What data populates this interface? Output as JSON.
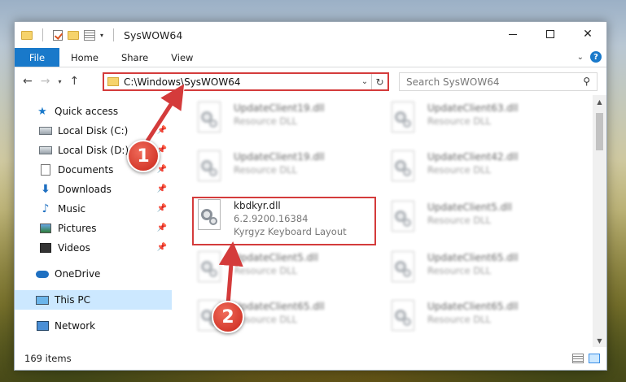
{
  "window": {
    "title": "SysWOW64",
    "minimize": "Minimize",
    "maximize": "Maximize",
    "close": "Close"
  },
  "ribbon": {
    "tabs": [
      "File",
      "Home",
      "Share",
      "View"
    ],
    "help": "?"
  },
  "address": {
    "path": "C:\\Windows\\SysWOW64",
    "search_placeholder": "Search SysWOW64"
  },
  "sidebar": {
    "quick_access": "Quick access",
    "items": [
      "Local Disk (C:)",
      "Local Disk (D:)",
      "Documents",
      "Downloads",
      "Music",
      "Pictures",
      "Videos"
    ],
    "onedrive": "OneDrive",
    "this_pc": "This PC",
    "network": "Network"
  },
  "files": {
    "left": [
      {
        "name": "UpdateClient19.dll",
        "sub": "Resource DLL"
      },
      {
        "name": "UpdateClient19.dll",
        "sub": "Resource DLL"
      },
      {
        "name": "kbdkyr.dll",
        "sub": "6.2.9200.16384",
        "sub2": "Kyrgyz Keyboard Layout"
      },
      {
        "name": "UpdateClient5.dll",
        "sub": "Resource DLL"
      },
      {
        "name": "UpdateClient65.dll",
        "sub": "Resource DLL"
      }
    ],
    "right": [
      {
        "name": "UpdateClient63.dll",
        "sub": "Resource DLL"
      },
      {
        "name": "UpdateClient42.dll",
        "sub": "Resource DLL"
      },
      {
        "name": "UpdateClient5.dll",
        "sub": "Resource DLL"
      },
      {
        "name": "UpdateClient65.dll",
        "sub": "Resource DLL"
      },
      {
        "name": "UpdateClient65.dll",
        "sub": "Resource DLL"
      }
    ]
  },
  "status": {
    "count": "169 items"
  },
  "annotations": {
    "step1": "1",
    "step2": "2",
    "color": "#d43b3b"
  }
}
